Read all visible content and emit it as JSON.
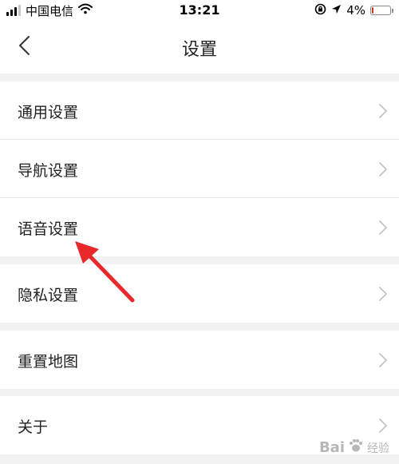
{
  "status_bar": {
    "carrier": "中国电信",
    "time": "13:21",
    "battery_percent": "4%",
    "battery_level": 0.04,
    "battery_color": "#e0331e"
  },
  "nav": {
    "title": "设置",
    "back_icon": "chevron-left-icon"
  },
  "groups": [
    {
      "items": [
        {
          "label": "通用设置"
        },
        {
          "label": "导航设置"
        },
        {
          "label": "语音设置"
        }
      ]
    },
    {
      "items": [
        {
          "label": "隐私设置"
        }
      ]
    },
    {
      "items": [
        {
          "label": "重置地图"
        }
      ]
    },
    {
      "items": [
        {
          "label": "关于"
        }
      ]
    }
  ],
  "annotation": {
    "color": "#e8282a"
  },
  "watermark": {
    "brand": "Bai",
    "suffix": "经验"
  }
}
